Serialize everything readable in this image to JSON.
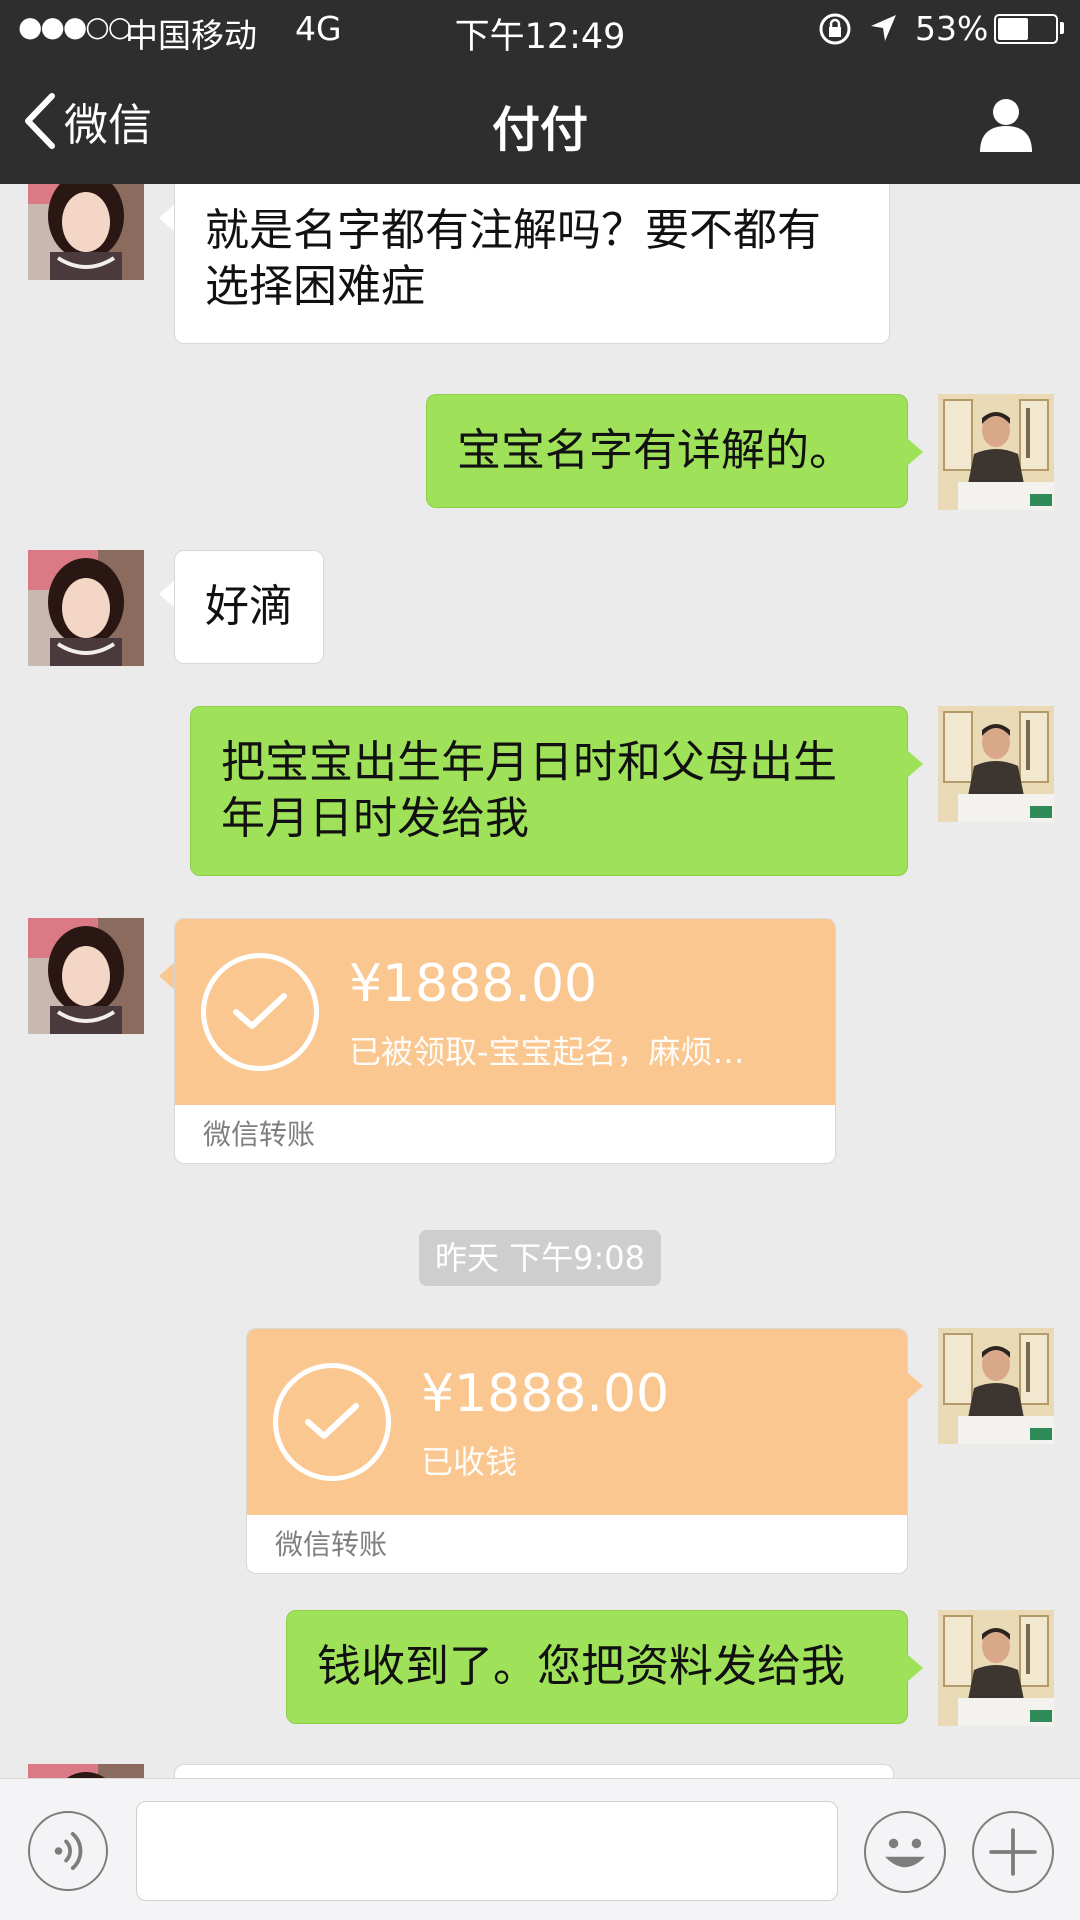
{
  "status_bar": {
    "signal": "●●●○○",
    "carrier": "中国移动",
    "network": "4G",
    "time": "下午12:49",
    "battery_percent": "53%",
    "battery_level": 0.53
  },
  "nav": {
    "back_label": "微信",
    "title": "付付"
  },
  "messages": [
    {
      "side": "left",
      "type": "text",
      "text": "就是名字都有注解吗？要不都有选择困难症"
    },
    {
      "side": "right",
      "type": "text",
      "text": "宝宝名字有详解的。"
    },
    {
      "side": "left",
      "type": "text",
      "text": "好滴"
    },
    {
      "side": "right",
      "type": "text",
      "text": "把宝宝出生年月日时和父母出生年月日时发给我"
    },
    {
      "side": "left",
      "type": "transfer",
      "amount": "¥1888.00",
      "status": "已被领取-宝宝起名，麻烦…",
      "footer": "微信转账"
    },
    {
      "type": "timestamp",
      "text": "昨天 下午9:08"
    },
    {
      "side": "right",
      "type": "transfer",
      "amount": "¥1888.00",
      "status": "已收钱",
      "footer": "微信转账"
    },
    {
      "side": "right",
      "type": "text",
      "text": "钱收到了。您把资料发给我"
    }
  ],
  "input_bar": {
    "placeholder": "",
    "icons": [
      "voice-icon",
      "emoji-icon",
      "plus-icon"
    ]
  },
  "colors": {
    "nav_bg": "#2e2e2e",
    "chat_bg": "#ebebeb",
    "green_bubble": "#9fe25a",
    "transfer_orange": "#fbc790"
  }
}
